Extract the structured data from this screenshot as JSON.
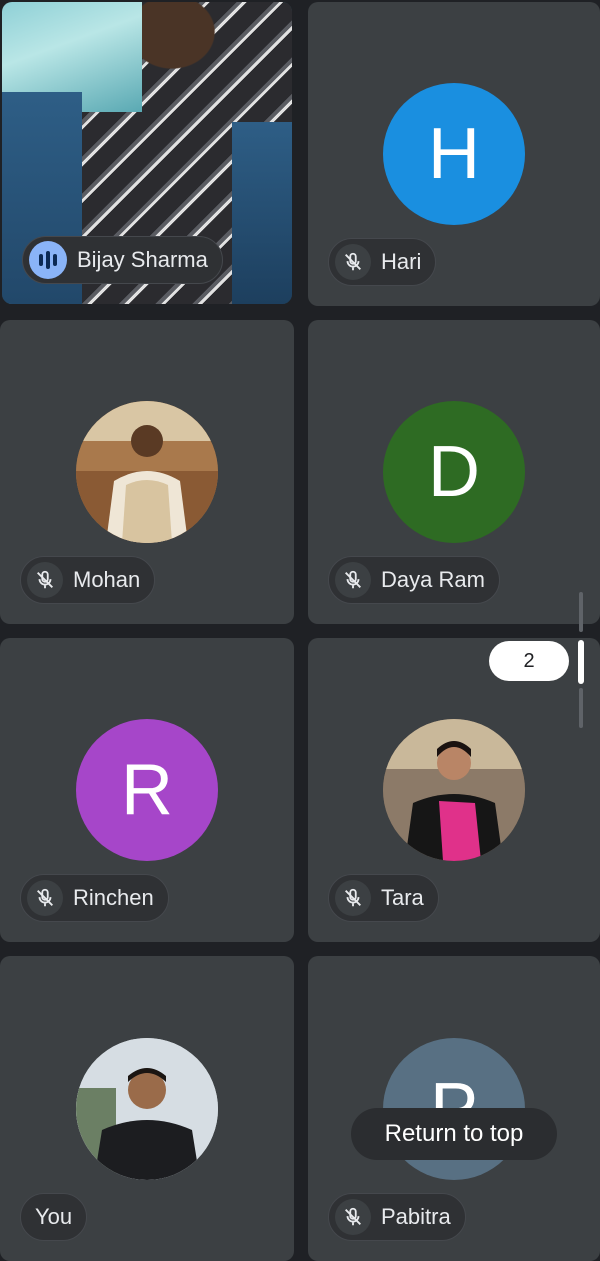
{
  "participants": [
    {
      "name": "Bijay Sharma",
      "state": "speaking",
      "type": "video"
    },
    {
      "name": "Hari",
      "state": "muted",
      "type": "initial",
      "initial": "H",
      "color": "#1a8fe0"
    },
    {
      "name": "Mohan",
      "state": "muted",
      "type": "photo"
    },
    {
      "name": "Daya Ram",
      "state": "muted",
      "type": "initial",
      "initial": "D",
      "color": "#2e6b23"
    },
    {
      "name": "Rinchen",
      "state": "muted",
      "type": "initial",
      "initial": "R",
      "color": "#a646c9"
    },
    {
      "name": "Tara",
      "state": "muted",
      "type": "photo"
    },
    {
      "name": "You",
      "state": "self",
      "type": "photo"
    },
    {
      "name": "Pabitra",
      "state": "muted",
      "type": "initial",
      "initial": "P",
      "color": "#587083"
    }
  ],
  "page_indicator": "2",
  "return_to_top_label": "Return to top",
  "icons": {
    "muted": "mic-off-icon",
    "speaking": "audio-level-icon"
  },
  "colors": {
    "background": "#1f2125",
    "tile": "#3c4043",
    "active_border": "#1e6e8c",
    "speaking_accent": "#8ab4f8"
  }
}
